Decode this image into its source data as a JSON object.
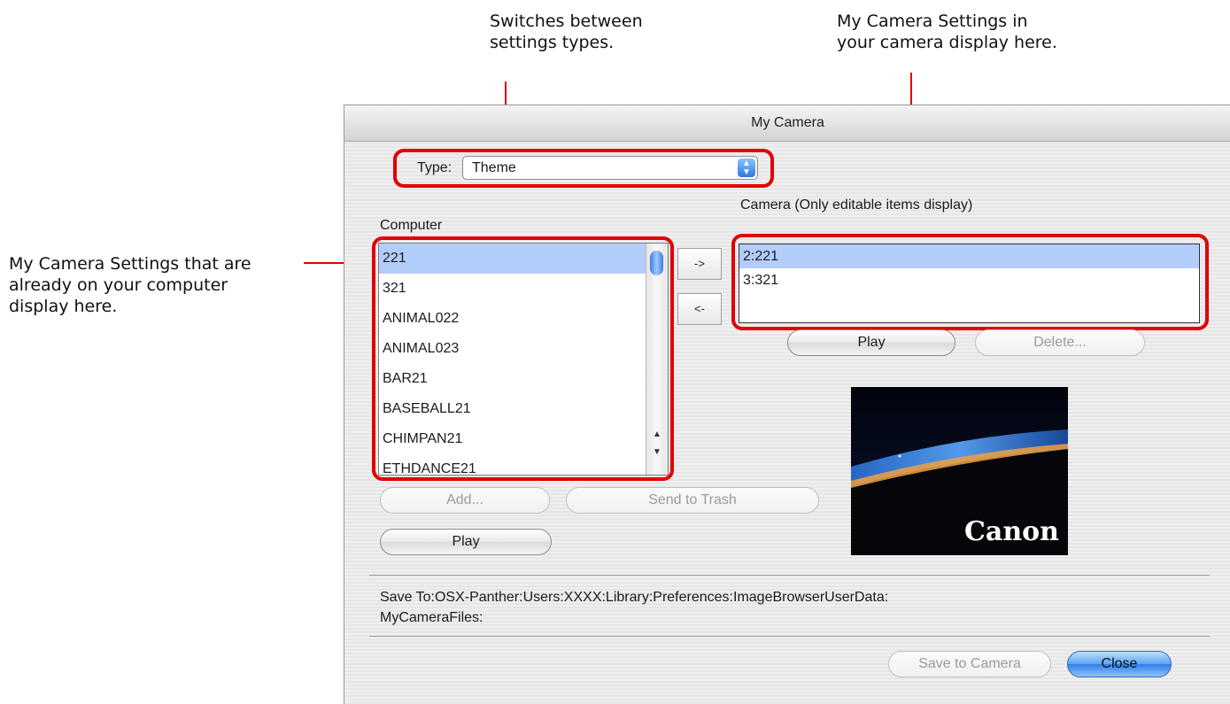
{
  "callouts": {
    "type_note": [
      "Switches between",
      "settings types."
    ],
    "camera_note": [
      "My Camera Settings in",
      "your camera display here."
    ],
    "computer_note": [
      "My Camera Settings that are",
      "already on your computer",
      "display here."
    ]
  },
  "window": {
    "title": "My Camera",
    "type_label": "Type:",
    "type_value": "Theme",
    "computer_label": "Computer",
    "camera_label": "Camera (Only editable items display)",
    "computer_items": [
      "221",
      "321",
      "ANIMAL022",
      "ANIMAL023",
      "BAR21",
      "BASEBALL21",
      "CHIMPAN21",
      "ETHDANCE21"
    ],
    "computer_selected_index": 0,
    "camera_items": [
      "2:221",
      "3:321"
    ],
    "camera_selected_index": 0,
    "buttons": {
      "to_camera": "->",
      "to_computer": "<-",
      "camera_play": "Play",
      "delete": "Delete...",
      "add": "Add...",
      "send_to_trash": "Send to Trash",
      "computer_play": "Play",
      "save_to_camera": "Save to Camera",
      "close": "Close"
    },
    "preview_logo": "Canon",
    "save_to_line1": "Save To:OSX-Panther:Users:XXXX:Library:Preferences:ImageBrowserUserData:",
    "save_to_line2": "MyCameraFiles:"
  },
  "colors": {
    "highlight": "#e00000",
    "selection": "#b3cdfb",
    "accent": "#2d7de6"
  }
}
